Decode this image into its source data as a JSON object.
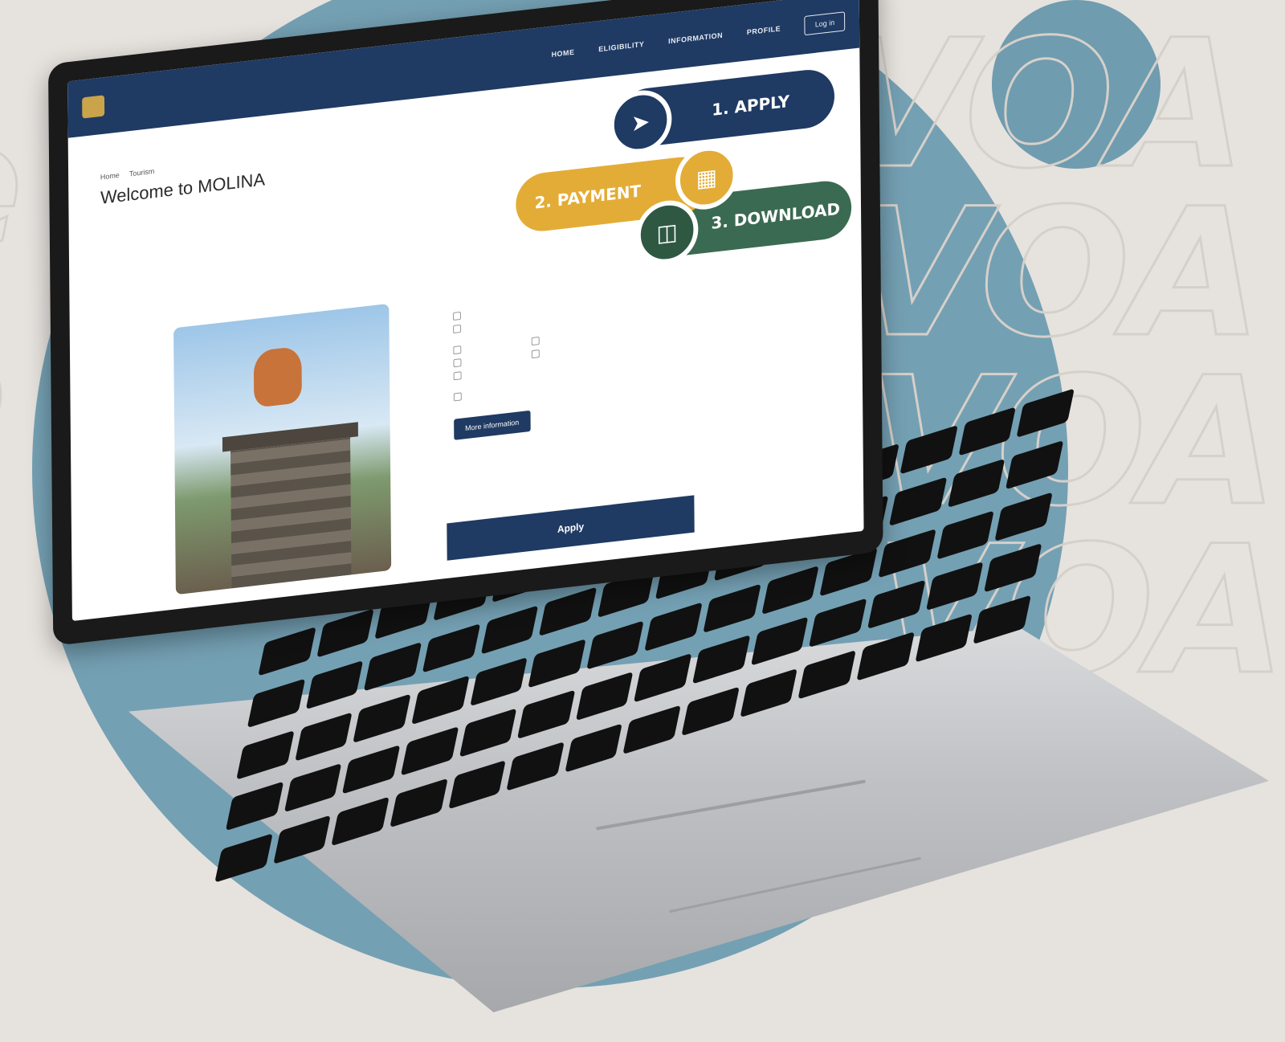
{
  "site": {
    "brand_line": "",
    "nav": [
      {
        "label": "HOME"
      },
      {
        "label": "ELIGIBILITY"
      },
      {
        "label": "INFORMATION"
      },
      {
        "label": "PROFILE"
      }
    ],
    "login_label": "Log in"
  },
  "breadcrumb": [
    "Home",
    "Tourism"
  ],
  "welcome_title": "Welcome to MOLINA",
  "intro_text": "",
  "photo_caption": "",
  "steps": [
    {
      "label": "1. APPLY",
      "icon": "paper-plane-icon",
      "color": "#1f3a63"
    },
    {
      "label": "2. PAYMENT",
      "icon": "card-coin-icon",
      "color": "#e3ac36"
    },
    {
      "label": "3. DOWNLOAD",
      "icon": "document-icon",
      "color": "#3b6a52"
    }
  ],
  "requirements": {
    "title": "",
    "items": [
      "",
      ""
    ],
    "subhead_1": "",
    "purposes_left": [
      "",
      "",
      ""
    ],
    "purposes_right": [
      "",
      ""
    ],
    "subhead_2": "",
    "eligible_item": ""
  },
  "more_info_label": "More information",
  "apply_label": "Apply",
  "colors": {
    "header": "#1f3a63",
    "accent_yellow": "#e3ac36",
    "accent_green": "#3b6a52",
    "bg_circle": "#74a0b3"
  }
}
